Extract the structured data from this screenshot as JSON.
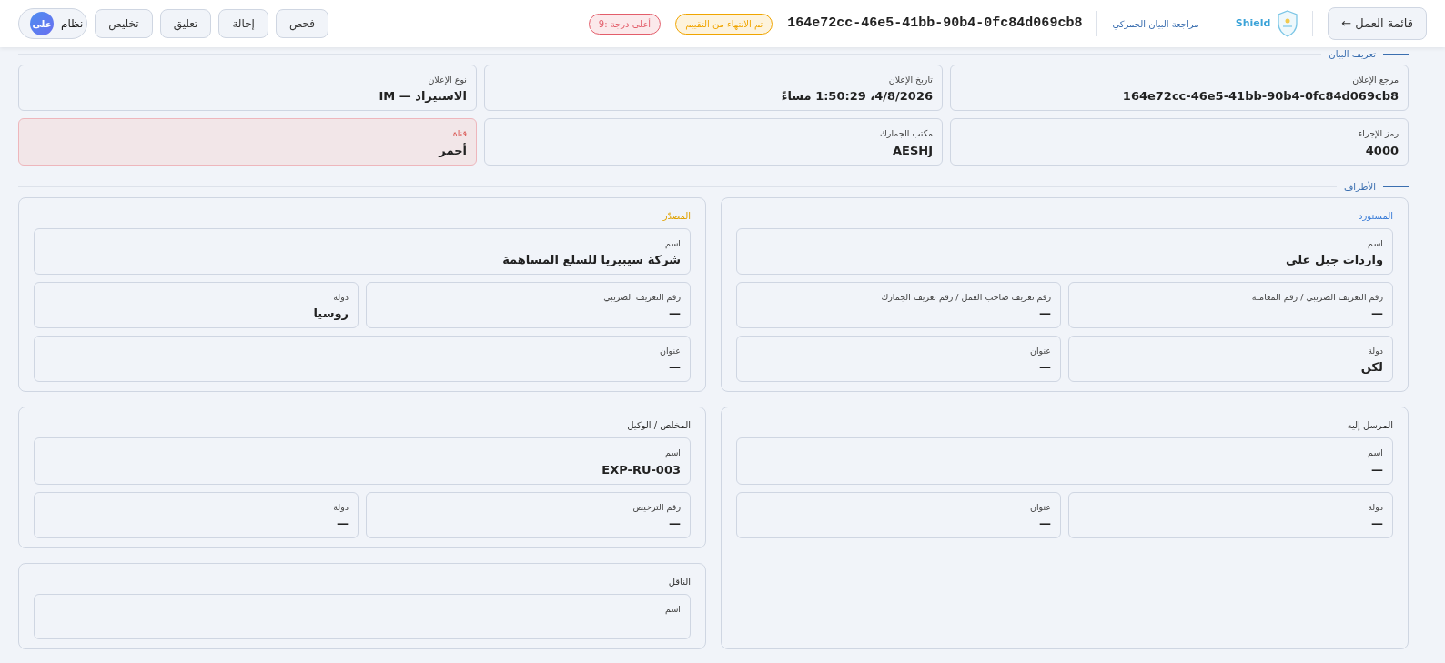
{
  "header": {
    "worklist_button": "قائمة العمل ←",
    "brand": "Shield",
    "app_title": "مراجعة البيان الجمركي",
    "declaration_id": "164e72cc-46e5-41bb-90b4-0fc84d069cb8",
    "badges": [
      {
        "text": "تم الانتهاء من التقييم",
        "color": "#f0a500"
      },
      {
        "text": "أعلى درجة :9",
        "color": "#e35d6a"
      }
    ],
    "actions": [
      "فحص",
      "إحالة",
      "تعليق",
      "تخليص"
    ],
    "user": {
      "name": "نظام",
      "initials": "على"
    }
  },
  "identification": {
    "title": "تعريف البيان",
    "fields": [
      {
        "label": "مرجع الإعلان",
        "value": "164e72cc-46e5-41bb-90b4-0fc84d069cb8",
        "alert": false
      },
      {
        "label": "تاريخ الإعلان",
        "value": "4/8/2026، 1:50:29 مساءً",
        "alert": false
      },
      {
        "label": "نوع الإعلان",
        "value": "الاستيراد — IM",
        "alert": false
      },
      {
        "label": "رمز الإجراء",
        "value": "4000",
        "alert": false
      },
      {
        "label": "مكتب الجمارك",
        "value": "AESHJ",
        "alert": false
      },
      {
        "label": "قناة",
        "value": "أحمر",
        "alert": true
      }
    ]
  },
  "parties": {
    "title": "الأطراف",
    "columns": [
      [
        {
          "title": "المستورد",
          "color": "#3b7dd8",
          "fields": [
            {
              "label": "اسم",
              "value": "واردات جبل علي",
              "wide": true
            },
            {
              "label": "رقم التعريف الضريبي / رقم المعاملة",
              "value": "—",
              "wide": false
            },
            {
              "label": "رقم تعريف صاحب العمل / رقم تعريف الجمارك",
              "value": "—",
              "wide": false
            },
            {
              "label": "دولة",
              "value": "لكن",
              "wide": false
            },
            {
              "label": "عنوان",
              "value": "—",
              "wide": false
            }
          ]
        },
        {
          "title": "المرسل إليه",
          "color": "#333333",
          "fields": [
            {
              "label": "اسم",
              "value": "—",
              "wide": true
            },
            {
              "label": "دولة",
              "value": "—",
              "wide": false
            },
            {
              "label": "عنوان",
              "value": "—",
              "wide": false
            }
          ]
        }
      ],
      [
        {
          "title": "المصدّر",
          "color": "#e0a100",
          "fields": [
            {
              "label": "اسم",
              "value": "شركة سيبيريا للسلع المساهمة",
              "wide": true
            },
            {
              "label": "رقم التعريف الضريبي",
              "value": "—",
              "wide": false
            },
            {
              "label": "دولة",
              "value": "روسيا",
              "wide": false
            },
            {
              "label": "عنوان",
              "value": "—",
              "wide": true
            }
          ]
        },
        {
          "title": "المخلص / الوكيل",
          "color": "#333333",
          "fields": [
            {
              "label": "اسم",
              "value": "EXP-RU-003",
              "wide": true
            },
            {
              "label": "رقم الترخيص",
              "value": "—",
              "wide": false
            },
            {
              "label": "دولة",
              "value": "—",
              "wide": false
            }
          ]
        },
        {
          "title": "الناقل",
          "color": "#333333",
          "fields": [
            {
              "label": "اسم",
              "wide": true
            }
          ]
        }
      ]
    ]
  }
}
